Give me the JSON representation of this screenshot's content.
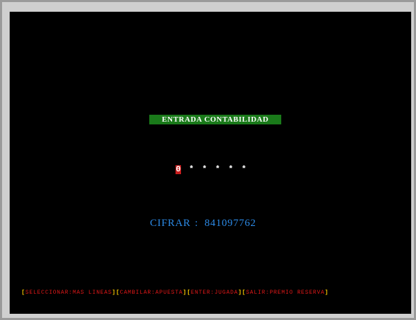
{
  "screen": {
    "title": "ENTRADA CONTABILIDAD",
    "pin": {
      "active_digit": "0",
      "masked": [
        "*",
        "*",
        "*",
        "*",
        "*"
      ]
    },
    "cipher": {
      "label": "CIFRAR",
      "separator": ":",
      "value": "841097762"
    },
    "footer": [
      {
        "label": "SELECCIONAR:MAS LINEAS"
      },
      {
        "label": "CAMBILAR:APUESTA"
      },
      {
        "label": "ENTER:JUGADA"
      },
      {
        "label": "SALIR:PREMIO RESERVA"
      }
    ]
  },
  "colors": {
    "background": "#000000",
    "title_bg": "#1a7a1a",
    "title_text": "#ffffff",
    "active_digit_bg": "#c81c1c",
    "cipher_text": "#2c8ae6",
    "bracket": "#ffcc00",
    "footer_text": "#e01818",
    "frame": "#9a9a9a"
  }
}
